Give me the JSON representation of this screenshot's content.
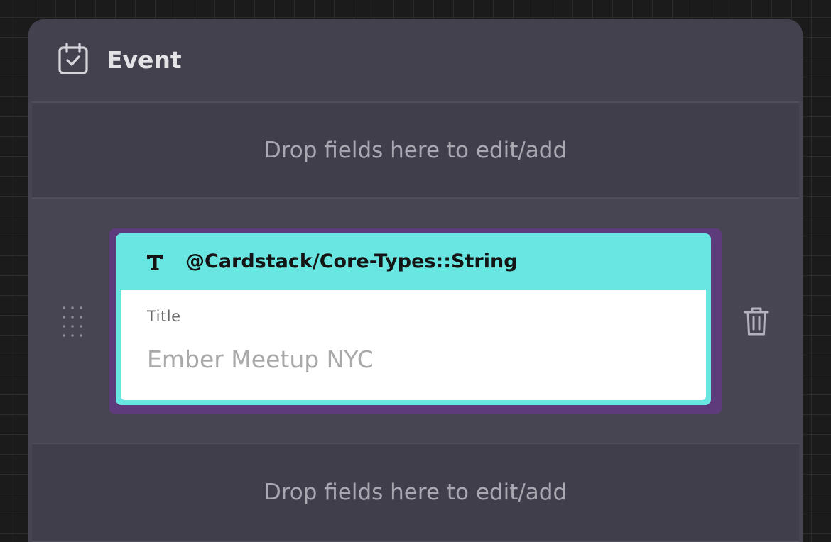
{
  "card": {
    "title": "Event",
    "icon": "calendar-check-icon"
  },
  "drop_zone_top": {
    "text": "Drop fields here to edit/add"
  },
  "field": {
    "type_icon": "text-type-icon",
    "type_label": "@Cardstack/Core-Types::String",
    "label": "Title",
    "value": "Ember Meetup NYC",
    "drag_icon": "drag-handle-icon",
    "delete_icon": "trash-icon"
  },
  "drop_zone_bottom": {
    "text": "Drop fields here to edit/add"
  },
  "colors": {
    "canvas": "#1b1b1c",
    "card": "#484553",
    "drop_zone": "#413e4c",
    "field_header": "#6ae6e2",
    "selection_border": "#5e3b7b",
    "field_body": "#ffffff"
  }
}
